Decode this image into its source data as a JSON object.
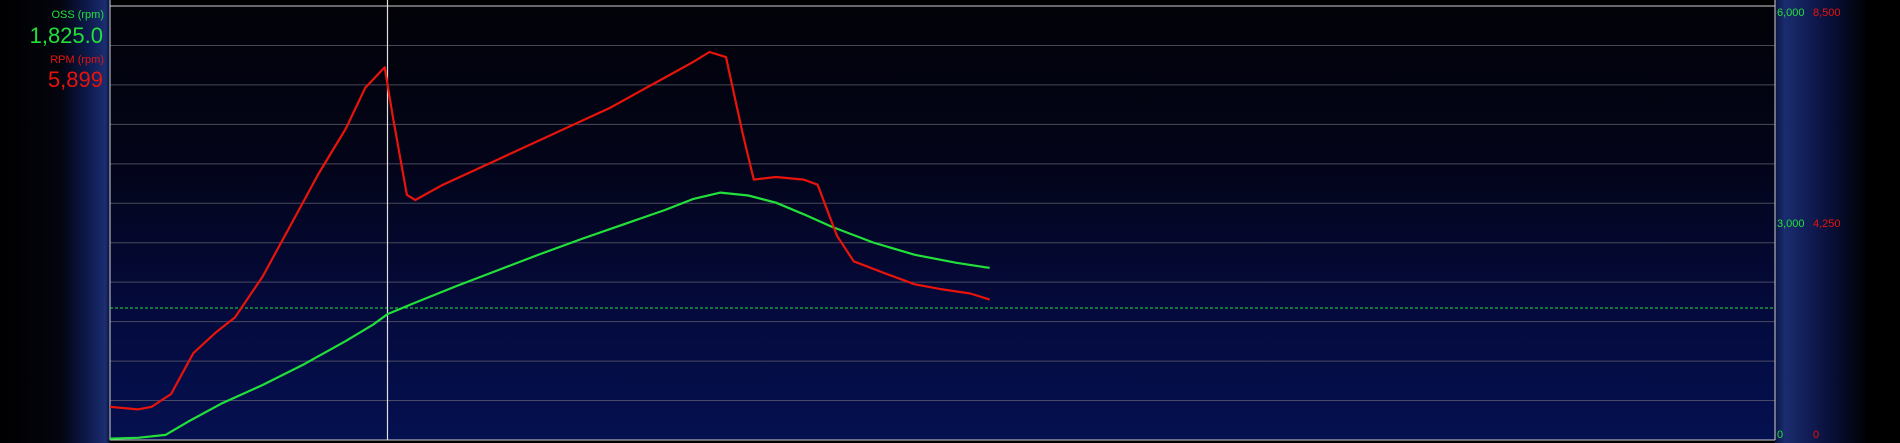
{
  "readouts": {
    "oss": {
      "label": "OSS (rpm)",
      "value": "1,825.0"
    },
    "rpm": {
      "label": "RPM (rpm)",
      "value": "5,899"
    }
  },
  "colors": {
    "oss": "#22e03a",
    "rpm": "#e8140c",
    "grid": "#5a5a6a",
    "frame": "#d0d0d0"
  },
  "chart_data": {
    "type": "line",
    "xlabel": "",
    "grid": true,
    "cursor_x": 100,
    "threshold_line": {
      "series": "OSS (rpm)",
      "value": 1825
    },
    "axes": [
      {
        "series": "OSS (rpm)",
        "range": [
          0,
          6000
        ],
        "ticks": [
          "6,000",
          "3,000",
          "0"
        ]
      },
      {
        "series": "RPM (rpm)",
        "range": [
          0,
          8500
        ],
        "ticks": [
          "8,500",
          "4,250",
          "0"
        ]
      }
    ],
    "series": [
      {
        "name": "OSS (rpm)",
        "axis": 0,
        "points": [
          [
            0,
            20
          ],
          [
            10,
            30
          ],
          [
            20,
            70
          ],
          [
            28,
            250
          ],
          [
            40,
            500
          ],
          [
            55,
            760
          ],
          [
            70,
            1050
          ],
          [
            85,
            1370
          ],
          [
            95,
            1600
          ],
          [
            100,
            1740
          ],
          [
            110,
            1900
          ],
          [
            125,
            2130
          ],
          [
            140,
            2350
          ],
          [
            155,
            2570
          ],
          [
            170,
            2780
          ],
          [
            185,
            2980
          ],
          [
            200,
            3180
          ],
          [
            210,
            3330
          ],
          [
            220,
            3420
          ],
          [
            230,
            3380
          ],
          [
            240,
            3280
          ],
          [
            250,
            3120
          ],
          [
            260,
            2950
          ],
          [
            275,
            2730
          ],
          [
            290,
            2560
          ],
          [
            305,
            2450
          ],
          [
            315,
            2390
          ],
          [
            317,
            2380
          ]
        ]
      },
      {
        "name": "RPM (rpm)",
        "axis": 1,
        "points": [
          [
            0,
            650
          ],
          [
            10,
            600
          ],
          [
            15,
            650
          ],
          [
            22,
            900
          ],
          [
            30,
            1700
          ],
          [
            38,
            2100
          ],
          [
            45,
            2400
          ],
          [
            55,
            3200
          ],
          [
            65,
            4200
          ],
          [
            75,
            5200
          ],
          [
            85,
            6100
          ],
          [
            92,
            6900
          ],
          [
            99,
            7300
          ],
          [
            102,
            6300
          ],
          [
            107,
            4800
          ],
          [
            110,
            4700
          ],
          [
            120,
            5000
          ],
          [
            140,
            5500
          ],
          [
            160,
            6000
          ],
          [
            180,
            6500
          ],
          [
            200,
            7100
          ],
          [
            210,
            7400
          ],
          [
            216,
            7600
          ],
          [
            222,
            7500
          ],
          [
            228,
            6000
          ],
          [
            232,
            5100
          ],
          [
            240,
            5150
          ],
          [
            250,
            5100
          ],
          [
            255,
            5000
          ],
          [
            262,
            4000
          ],
          [
            268,
            3500
          ],
          [
            280,
            3250
          ],
          [
            290,
            3050
          ],
          [
            300,
            2950
          ],
          [
            310,
            2870
          ],
          [
            317,
            2750
          ]
        ]
      }
    ],
    "x_range": [
      0,
      600
    ]
  }
}
